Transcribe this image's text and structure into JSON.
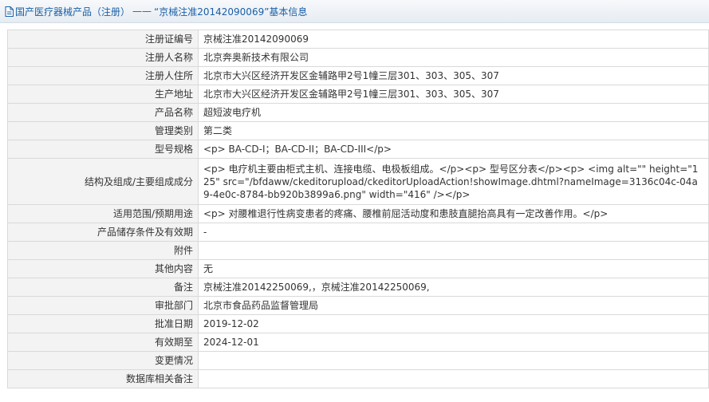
{
  "header": {
    "category": "国产医疗器械产品（注册）",
    "separator": "——",
    "record_title": "“京械注准20142090069”基本信息"
  },
  "rows": [
    {
      "label": "注册证编号",
      "value": "京械注准20142090069"
    },
    {
      "label": "注册人名称",
      "value": "北京奔奥新技术有限公司"
    },
    {
      "label": "注册人住所",
      "value": "北京市大兴区经济开发区金辅路甲2号1幢三层301、303、305、307"
    },
    {
      "label": "生产地址",
      "value": "北京市大兴区经济开发区金辅路甲2号1幢三层301、303、305、307"
    },
    {
      "label": "产品名称",
      "value": "超短波电疗机"
    },
    {
      "label": "管理类别",
      "value": "第二类"
    },
    {
      "label": "型号规格",
      "value": "<p> BA-CD-I；BA-CD-II；BA-CD-III</p>"
    },
    {
      "label": "结构及组成/主要组成成分",
      "value": "<p> 电疗机主要由柜式主机、连接电缆、电极板组成。</p><p> 型号区分表</p><p> <img alt=\"\" height=\"125\" src=\"/bfdaww/ckeditorupload/ckeditorUploadAction!showImage.dhtml?nameImage=3136c04c-04a9-4e0c-8784-bb920b3899a6.png\" width=\"416\" /></p>"
    },
    {
      "label": "适用范围/预期用途",
      "value": "<p> 对腰椎退行性病变患者的疼痛、腰椎前屈活动度和患肢直腿抬高具有一定改善作用。</p>"
    },
    {
      "label": "产品储存条件及有效期",
      "value": "-"
    },
    {
      "label": "附件",
      "value": ""
    },
    {
      "label": "其他内容",
      "value": "无"
    },
    {
      "label": "备注",
      "value": "京械注准20142250069,，京械注准20142250069,"
    },
    {
      "label": "审批部门",
      "value": "北京市食品药品监督管理局"
    },
    {
      "label": "批准日期",
      "value": "2019-12-02"
    },
    {
      "label": "有效期至",
      "value": "2024-12-01"
    },
    {
      "label": "变更情况",
      "value": ""
    },
    {
      "label": "数据库相关备注",
      "value": ""
    }
  ]
}
